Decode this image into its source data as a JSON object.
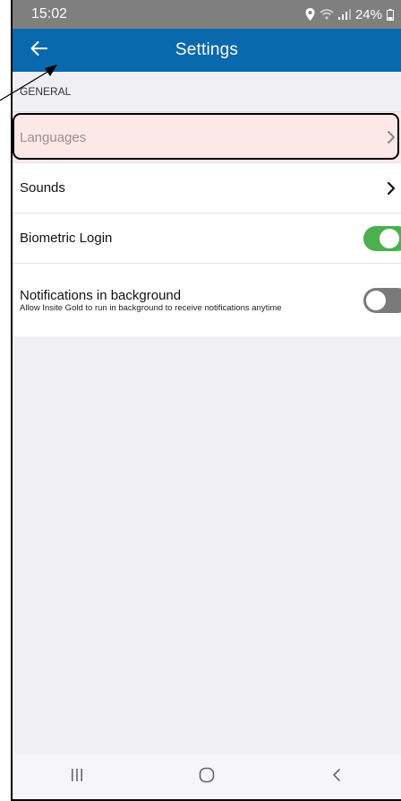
{
  "status_bar": {
    "time": "15:02",
    "battery": "24%",
    "icons": [
      "location-icon",
      "wifi-icon",
      "signal-icon",
      "battery-icon"
    ]
  },
  "app_bar": {
    "title": "Settings",
    "back_icon": "back-arrow-icon"
  },
  "section": {
    "title": "GENERAL"
  },
  "items": [
    {
      "label": "Languages",
      "type": "link",
      "highlighted": true
    },
    {
      "label": "Sounds",
      "type": "link"
    },
    {
      "label": "Biometric Login",
      "type": "toggle",
      "enabled": true
    },
    {
      "label": "Notifications in background",
      "sublabel": "Allow Insite Gold to run in background to receive notifications anytime",
      "type": "toggle",
      "enabled": false
    }
  ],
  "nav_bar": {
    "icons": [
      "recent-apps-icon",
      "home-icon",
      "back-icon"
    ]
  },
  "colors": {
    "app_bar": "#0a68ad",
    "status_bar": "#7f7f7f",
    "toggle_on": "#4caf50",
    "toggle_off": "#7a7a7a",
    "highlight": "#fde8e8",
    "background": "#efeff4"
  }
}
